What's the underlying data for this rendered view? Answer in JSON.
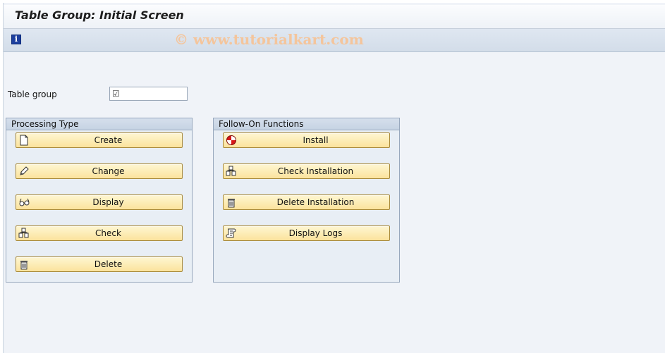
{
  "screen": {
    "title": "Table Group: Initial Screen",
    "watermark": "© www.tutorialkart.com"
  },
  "toolbar": {
    "info_icon": "information-icon"
  },
  "form": {
    "table_group_label": "Table group",
    "table_group_value": "",
    "required_marker": "☑"
  },
  "processing_type": {
    "title": "Processing Type",
    "buttons": [
      {
        "label": "Create",
        "icon": "new-document-icon"
      },
      {
        "label": "Change",
        "icon": "pencil-icon"
      },
      {
        "label": "Display",
        "icon": "glasses-icon"
      },
      {
        "label": "Check",
        "icon": "check-structure-icon"
      },
      {
        "label": "Delete",
        "icon": "trash-icon"
      }
    ]
  },
  "follow_on": {
    "title": "Follow-On Functions",
    "buttons": [
      {
        "label": "Install",
        "icon": "install-icon"
      },
      {
        "label": "Check Installation",
        "icon": "check-structure-icon"
      },
      {
        "label": "Delete Installation",
        "icon": "trash-icon"
      },
      {
        "label": "Display Logs",
        "icon": "log-scroll-icon"
      }
    ]
  }
}
